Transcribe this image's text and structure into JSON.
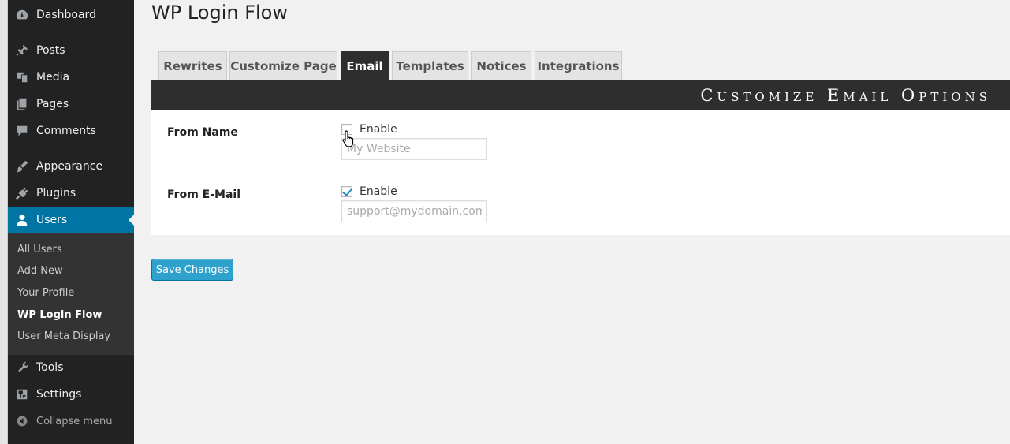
{
  "sidebar": {
    "items": [
      {
        "label": "Dashboard",
        "icon": "dashboard-icon"
      },
      {
        "label": "Posts",
        "icon": "pin-icon"
      },
      {
        "label": "Media",
        "icon": "media-icon"
      },
      {
        "label": "Pages",
        "icon": "pages-icon"
      },
      {
        "label": "Comments",
        "icon": "comment-icon"
      },
      {
        "label": "Appearance",
        "icon": "brush-icon"
      },
      {
        "label": "Plugins",
        "icon": "plug-icon"
      },
      {
        "label": "Users",
        "icon": "user-icon"
      },
      {
        "label": "Tools",
        "icon": "wrench-icon"
      },
      {
        "label": "Settings",
        "icon": "settings-icon"
      }
    ],
    "submenu": [
      "All Users",
      "Add New",
      "Your Profile",
      "WP Login Flow",
      "User Meta Display"
    ],
    "collapse_label": "Collapse menu"
  },
  "page_title": "WP Login Flow",
  "tabs": [
    "Rewrites",
    "Customize Page",
    "Email",
    "Templates",
    "Notices",
    "Integrations"
  ],
  "active_tab": "Email",
  "panel_title": "Customize Email Options",
  "fields": [
    {
      "label": "From Name",
      "checkbox_label": "Enable",
      "checked": false,
      "placeholder": "My Website"
    },
    {
      "label": "From E-Mail",
      "checkbox_label": "Enable",
      "checked": true,
      "placeholder": "support@mydomain.com"
    }
  ],
  "save_label": "Save Changes",
  "colors": {
    "sidebar": "#222222",
    "accent": "#0074a2",
    "button": "#2ea2cc",
    "panel_header": "#2e2e2e"
  }
}
